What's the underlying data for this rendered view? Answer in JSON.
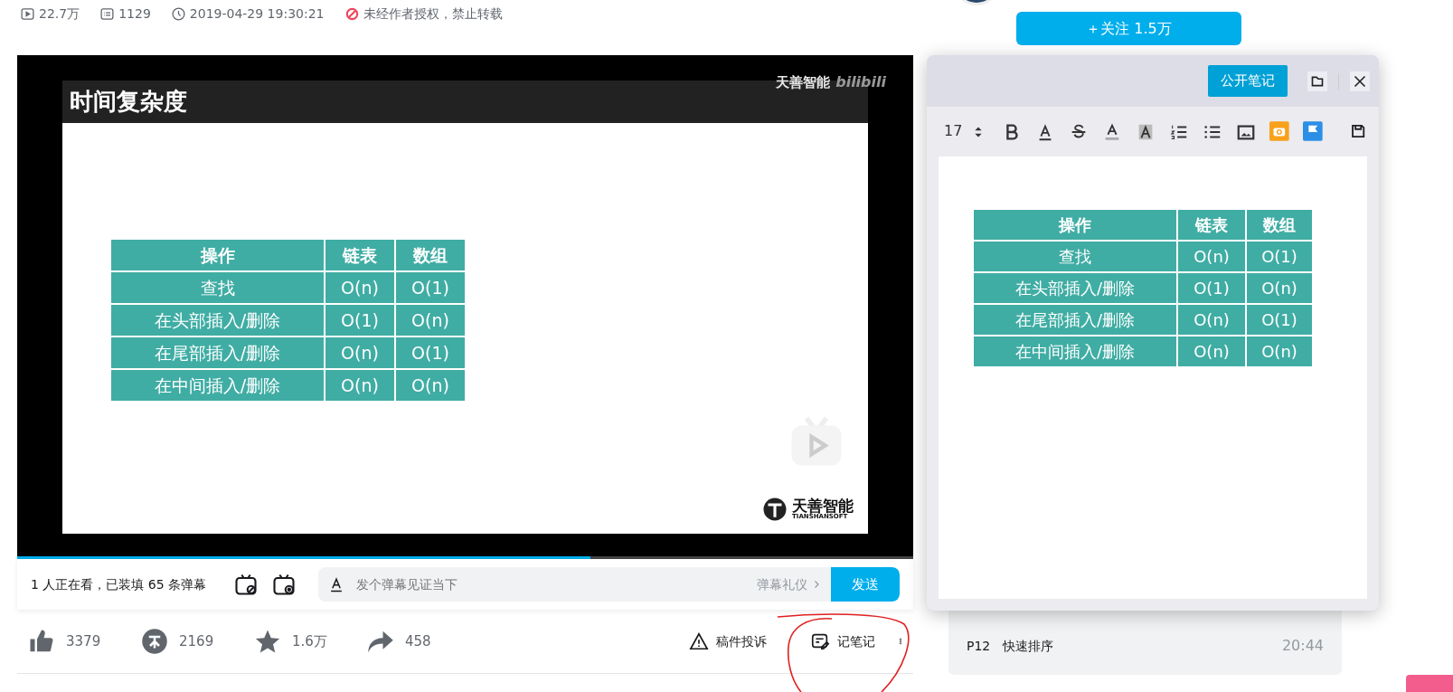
{
  "stats": [
    {
      "kind": "play",
      "text": "22.7万"
    },
    {
      "kind": "danmaku",
      "text": "1129"
    },
    {
      "kind": "clock",
      "text": "2019-04-29 19:30:21"
    },
    {
      "kind": "forbid",
      "text": "未经作者授权，禁止转载"
    }
  ],
  "follow_button": "＋关注 1.5万",
  "player": {
    "brand": "天善智能",
    "site_logo": "bilibili",
    "progress": {
      "level": 0.64
    },
    "slide": {
      "title": "时间复杂度",
      "logo_name": "天善智能",
      "logo_sub": "TIANSHANSOFT",
      "table": {
        "columns": [
          "操作",
          "链表",
          "数组"
        ],
        "rows": [
          [
            "查找",
            "O(n)",
            "O(1)"
          ],
          [
            "在头部插入/删除",
            "O(1)",
            "O(n)"
          ],
          [
            "在尾部插入/删除",
            "O(n)",
            "O(1)"
          ],
          [
            "在中间插入/删除",
            "O(n)",
            "O(n)"
          ]
        ]
      }
    }
  },
  "danmaku_bar": {
    "viewers": "1 人正在看，已装填 65 条弹幕",
    "placeholder": "发个弹幕见证当下",
    "etiquette": "弹幕礼仪",
    "send": "发送"
  },
  "actions": [
    {
      "kind": "like",
      "text": "3379"
    },
    {
      "kind": "coin",
      "text": "2169"
    },
    {
      "kind": "favorite",
      "text": "1.6万"
    },
    {
      "kind": "share",
      "text": "458"
    }
  ],
  "tools": [
    {
      "kind": "report",
      "text": "稿件投诉"
    },
    {
      "kind": "note",
      "text": "记笔记"
    }
  ],
  "notes": {
    "publish": "公开笔记",
    "font_size": "17",
    "table": {
      "columns": [
        "操作",
        "链表",
        "数组"
      ],
      "rows": [
        [
          "查找",
          "O(n)",
          "O(1)"
        ],
        [
          "在头部插入/删除",
          "O(1)",
          "O(n)"
        ],
        [
          "在尾部插入/删除",
          "O(n)",
          "O(1)"
        ],
        [
          "在中间插入/删除",
          "O(n)",
          "O(n)"
        ]
      ]
    }
  },
  "playlist": [
    {
      "index": "P12",
      "title": "快速排序",
      "duration": "20:44"
    }
  ]
}
